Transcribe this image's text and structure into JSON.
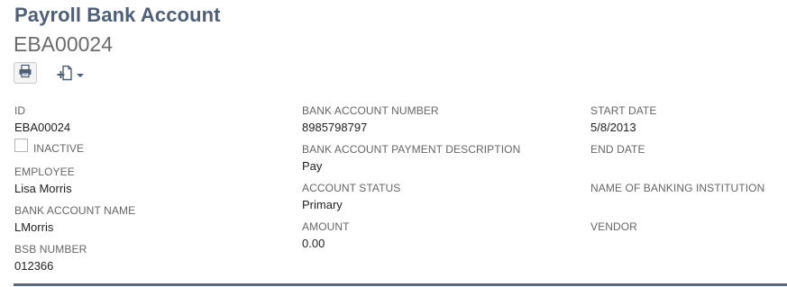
{
  "header": {
    "record_type": "Payroll Bank Account",
    "record_id": "EBA00024"
  },
  "toolbar": {
    "print_icon": "printer-icon",
    "new_icon": "new-document-icon"
  },
  "fields": {
    "col1": {
      "id_label": "ID",
      "id_value": "EBA00024",
      "inactive_label": "INACTIVE",
      "inactive_checked": false,
      "employee_label": "EMPLOYEE",
      "employee_value": "Lisa Morris",
      "bank_account_name_label": "BANK ACCOUNT NAME",
      "bank_account_name_value": "LMorris",
      "bsb_label": "BSB NUMBER",
      "bsb_value": "012366"
    },
    "col2": {
      "account_number_label": "BANK ACCOUNT NUMBER",
      "account_number_value": "8985798797",
      "payment_description_label": "BANK ACCOUNT PAYMENT DESCRIPTION",
      "payment_description_value": "Pay",
      "account_status_label": "ACCOUNT STATUS",
      "account_status_value": "Primary",
      "amount_label": "AMOUNT",
      "amount_value": "0.00"
    },
    "col3": {
      "start_date_label": "START DATE",
      "start_date_value": "5/8/2013",
      "end_date_label": "END DATE",
      "end_date_value": "",
      "bank_institution_label": "NAME OF BANKING INSTITUTION",
      "bank_institution_value": "",
      "vendor_label": "VENDOR",
      "vendor_value": ""
    }
  },
  "colors": {
    "title": "#4d5f79",
    "subtitle": "#6b6b6b",
    "rule": "#5a6a82"
  }
}
